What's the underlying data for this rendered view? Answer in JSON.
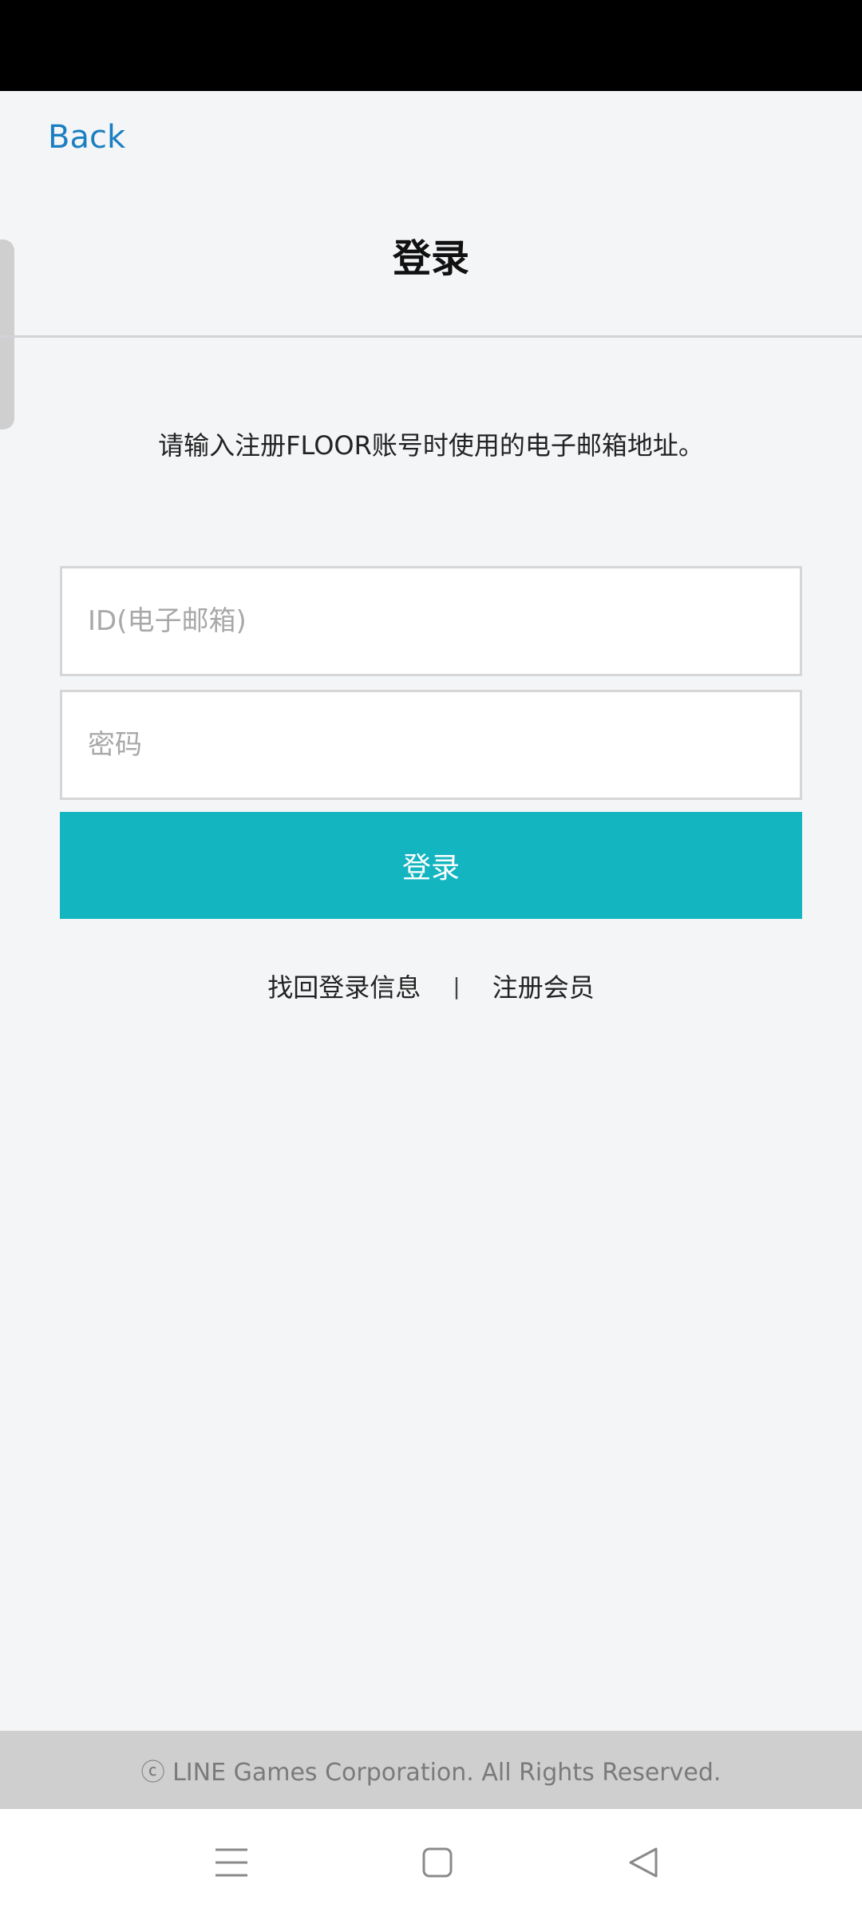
{
  "header": {
    "back_label": "Back",
    "title": "登录"
  },
  "instruction": "请输入注册FLOOR账号时使用的电子邮箱地址。",
  "form": {
    "id_placeholder": "ID(电子邮箱)",
    "password_placeholder": "密码",
    "login_label": "登录"
  },
  "links": {
    "find_login_info": "找回登录信息",
    "separator": "|",
    "register": "注册会员"
  },
  "footer": {
    "copyright": "ⓒ LINE Games Corporation. All Rights Reserved."
  },
  "nav_icons": [
    "menu-icon",
    "home-icon",
    "back-icon"
  ],
  "colors": {
    "accent": "#13b5c1",
    "link": "#1a7fc1",
    "background": "#f4f5f7",
    "footer_bg": "#cfcfcf"
  }
}
